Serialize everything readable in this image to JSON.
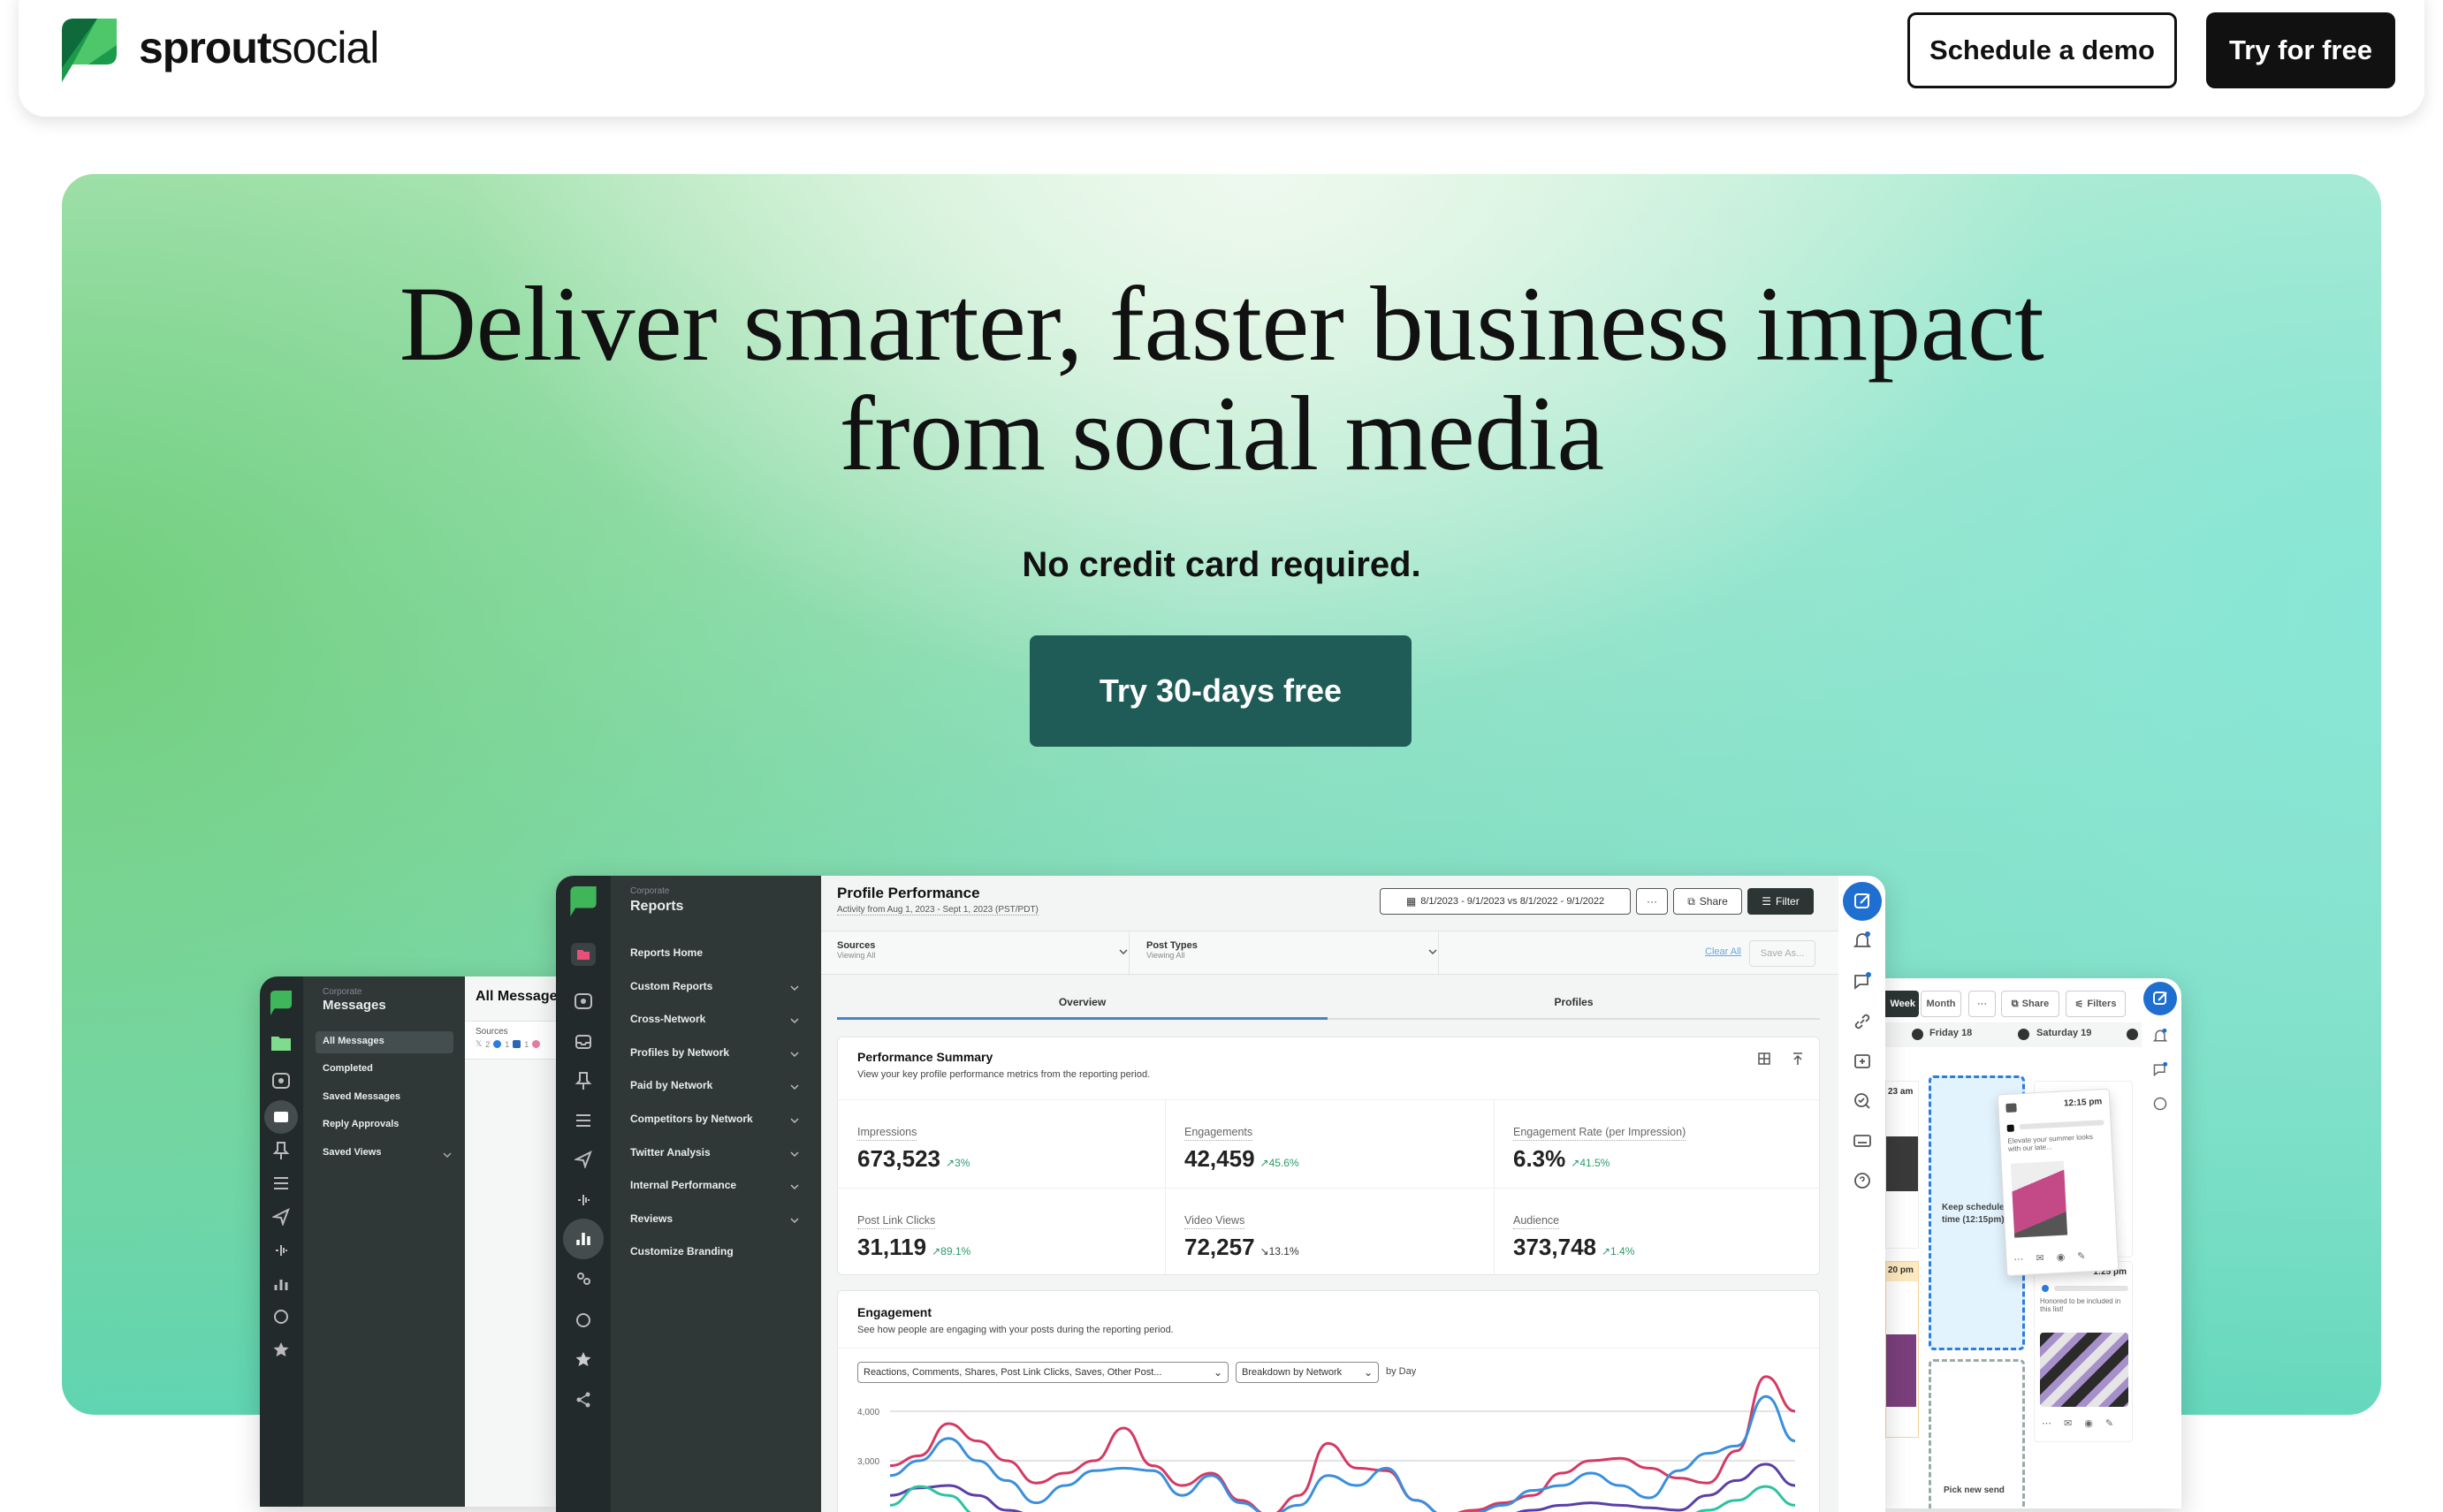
{
  "header": {
    "logo_bold": "sprout",
    "logo_light": "social",
    "schedule_demo": "Schedule a demo",
    "try_free": "Try for free"
  },
  "hero": {
    "title_line1": "Deliver smarter, faster business impact",
    "title_line2": "from social media",
    "subtitle": "No credit card required.",
    "cta": "Try 30-days free"
  },
  "colors": {
    "cta_bg": "#1f5c57",
    "dark_rail": "#232a2b",
    "dark_nav": "#2f3737",
    "accent_blue": "#1f6fd1",
    "positive_delta": "#2b9a6a"
  },
  "messages_panel": {
    "workspace": "Corporate",
    "title": "Messages",
    "nav": [
      "All Messages",
      "Completed",
      "Saved Messages",
      "Reply Approvals",
      "Saved Views"
    ],
    "content_title": "All Messages",
    "sources_label": "Sources",
    "source_counts": [
      "2",
      "1",
      "1"
    ]
  },
  "reports_panel": {
    "workspace": "Corporate",
    "title": "Reports",
    "nav": [
      {
        "label": "Reports Home",
        "expandable": false
      },
      {
        "label": "Custom Reports",
        "expandable": true
      },
      {
        "label": "Cross-Network",
        "expandable": true
      },
      {
        "label": "Profiles by Network",
        "expandable": true
      },
      {
        "label": "Paid by Network",
        "expandable": true
      },
      {
        "label": "Competitors by Network",
        "expandable": true
      },
      {
        "label": "Twitter Analysis",
        "expandable": true
      },
      {
        "label": "Internal Performance",
        "expandable": true
      },
      {
        "label": "Reviews",
        "expandable": true
      },
      {
        "label": "Customize Branding",
        "expandable": false
      }
    ],
    "page_title": "Profile Performance",
    "page_subtitle": "Activity from Aug 1, 2023 - Sept 1, 2023 (PST/PDT)",
    "date_range": "8/1/2023 - 9/1/2023 vs 8/1/2022 - 9/1/2022",
    "more_label": "···",
    "share_label": "Share",
    "filter_label": "Filter",
    "filters": [
      {
        "label": "Sources",
        "value": "Viewing All"
      },
      {
        "label": "Post Types",
        "value": "Viewing All"
      }
    ],
    "clear_all": "Clear All",
    "save_as": "Save As...",
    "tabs": [
      {
        "label": "Overview",
        "active": true
      },
      {
        "label": "Profiles",
        "active": false
      }
    ],
    "summary": {
      "title": "Performance Summary",
      "description": "View your key profile performance metrics from the reporting period.",
      "metrics": [
        {
          "label": "Impressions",
          "value": "673,523",
          "delta": "3%",
          "trend": "up"
        },
        {
          "label": "Engagements",
          "value": "42,459",
          "delta": "45.6%",
          "trend": "up"
        },
        {
          "label": "Engagement Rate (per Impression)",
          "value": "6.3%",
          "delta": "41.5%",
          "trend": "up"
        },
        {
          "label": "Post Link Clicks",
          "value": "31,119",
          "delta": "89.1%",
          "trend": "up"
        },
        {
          "label": "Video Views",
          "value": "72,257",
          "delta": "13.1%",
          "trend": "down"
        },
        {
          "label": "Audience",
          "value": "373,748",
          "delta": "1.4%",
          "trend": "up"
        }
      ]
    },
    "engagement": {
      "title": "Engagement",
      "description": "See how people are engaging with your posts during the reporting period.",
      "metric_select": "Reactions, Comments, Shares, Post Link Clicks, Saves, Other Post...",
      "breakdown_select": "Breakdown by Network",
      "by_label": "by Day"
    }
  },
  "chart_data": {
    "type": "line",
    "title": "",
    "xlabel": "",
    "ylabel": "",
    "y_ticks": [
      "4,000",
      "3,000"
    ],
    "grid": true,
    "series": [
      {
        "color": "#d43a63",
        "values": [
          2900,
          3100,
          3750,
          3400,
          3000,
          2550,
          2750,
          3000,
          3660,
          2900,
          2500,
          2750,
          2200,
          1900,
          2300,
          3350,
          2850,
          2800,
          2200,
          1900,
          2000,
          2150,
          2300,
          2750,
          3000,
          3050,
          2850,
          2650,
          2550,
          3200,
          4700,
          4000
        ]
      },
      {
        "color": "#3a8fdc",
        "values": [
          2700,
          3000,
          3450,
          3000,
          2600,
          2150,
          2500,
          2800,
          2850,
          2800,
          2300,
          2700,
          2150,
          1900,
          2100,
          2700,
          2500,
          2850,
          2200,
          1900,
          1950,
          2100,
          2400,
          2500,
          2750,
          2500,
          2250,
          2800,
          3150,
          3300,
          4300,
          3400
        ]
      },
      {
        "color": "#5b3fa8",
        "values": [
          2300,
          2450,
          2500,
          2300,
          2000,
          1900,
          1850,
          1850,
          1900,
          1900,
          1850,
          1800,
          1800,
          1800,
          1850,
          1900,
          1900,
          1850,
          1800,
          1800,
          1850,
          1900,
          2000,
          2100,
          2150,
          2100,
          2050,
          2000,
          2300,
          2600,
          2930,
          2500
        ]
      },
      {
        "color": "#2cc3a0",
        "values": [
          2100,
          2480,
          2300,
          1900,
          1700,
          1700,
          1700,
          1750,
          1750,
          1700,
          1700,
          1700,
          1700,
          1700,
          1700,
          1750,
          1750,
          1700,
          1700,
          1700,
          1700,
          1750,
          1800,
          1800,
          1800,
          1750,
          1750,
          1800,
          2000,
          2200,
          2480,
          2100
        ]
      }
    ]
  },
  "calendar_panel": {
    "view_week": "Week",
    "view_month": "Month",
    "more_label": "···",
    "share_label": "Share",
    "filters_label": "Filters",
    "days": [
      "Friday 18",
      "Saturday 19"
    ],
    "left_times": [
      "23 am",
      "20 pm"
    ],
    "drop_target": "Keep scheduled time (12:15pm)",
    "new_target": "Pick new send",
    "drag_card": {
      "time": "12:15 pm",
      "text": "Elevate your summer looks with our late..."
    },
    "post_card": {
      "time": "1:25 pm",
      "text": "Honored to be included in this list!"
    }
  }
}
